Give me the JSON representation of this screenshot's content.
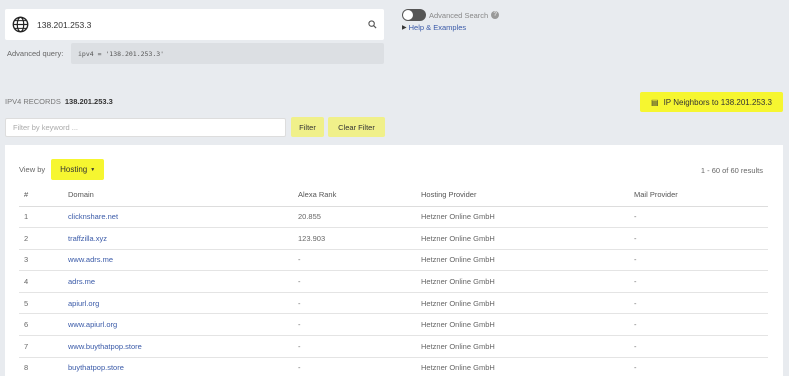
{
  "search": {
    "value": "138.201.253.3"
  },
  "advanced_query": {
    "label": "Advanced query:",
    "value": "ipv4 = '138.201.253.3'"
  },
  "advanced_search": {
    "label": "Advanced Search",
    "enabled": false
  },
  "help": {
    "label": "Help & Examples"
  },
  "records": {
    "label": "IPV4 RECORDS",
    "ip": "138.201.253.3"
  },
  "neighbors_button": {
    "label": "IP Neighbors to 138.201.253.3"
  },
  "filter": {
    "placeholder": "Filter by keyword ...",
    "filter_label": "Filter",
    "clear_label": "Clear Filter"
  },
  "viewby": {
    "label": "View by",
    "selected": "Hosting"
  },
  "results_text": "1 - 60 of 60 results",
  "table": {
    "headers": {
      "num": "#",
      "domain": "Domain",
      "alexa": "Alexa Rank",
      "hosting": "Hosting Provider",
      "mail": "Mail Provider"
    },
    "rows": [
      {
        "num": "1",
        "domain": "clicknshare.net",
        "alexa": "20.855",
        "hosting": "Hetzner Online GmbH",
        "mail": "-"
      },
      {
        "num": "2",
        "domain": "traffzilla.xyz",
        "alexa": "123.903",
        "hosting": "Hetzner Online GmbH",
        "mail": "-"
      },
      {
        "num": "3",
        "domain": "www.adrs.me",
        "alexa": "-",
        "hosting": "Hetzner Online GmbH",
        "mail": "-"
      },
      {
        "num": "4",
        "domain": "adrs.me",
        "alexa": "-",
        "hosting": "Hetzner Online GmbH",
        "mail": "-"
      },
      {
        "num": "5",
        "domain": "apiurl.org",
        "alexa": "-",
        "hosting": "Hetzner Online GmbH",
        "mail": "-"
      },
      {
        "num": "6",
        "domain": "www.apiurl.org",
        "alexa": "-",
        "hosting": "Hetzner Online GmbH",
        "mail": "-"
      },
      {
        "num": "7",
        "domain": "www.buythatpop.store",
        "alexa": "-",
        "hosting": "Hetzner Online GmbH",
        "mail": "-"
      },
      {
        "num": "8",
        "domain": "buythatpop.store",
        "alexa": "-",
        "hosting": "Hetzner Online GmbH",
        "mail": "-"
      }
    ]
  },
  "colors": {
    "accent_yellow": "#f6f630",
    "link_blue": "#3a5aa8",
    "background": "#e8ebef"
  }
}
